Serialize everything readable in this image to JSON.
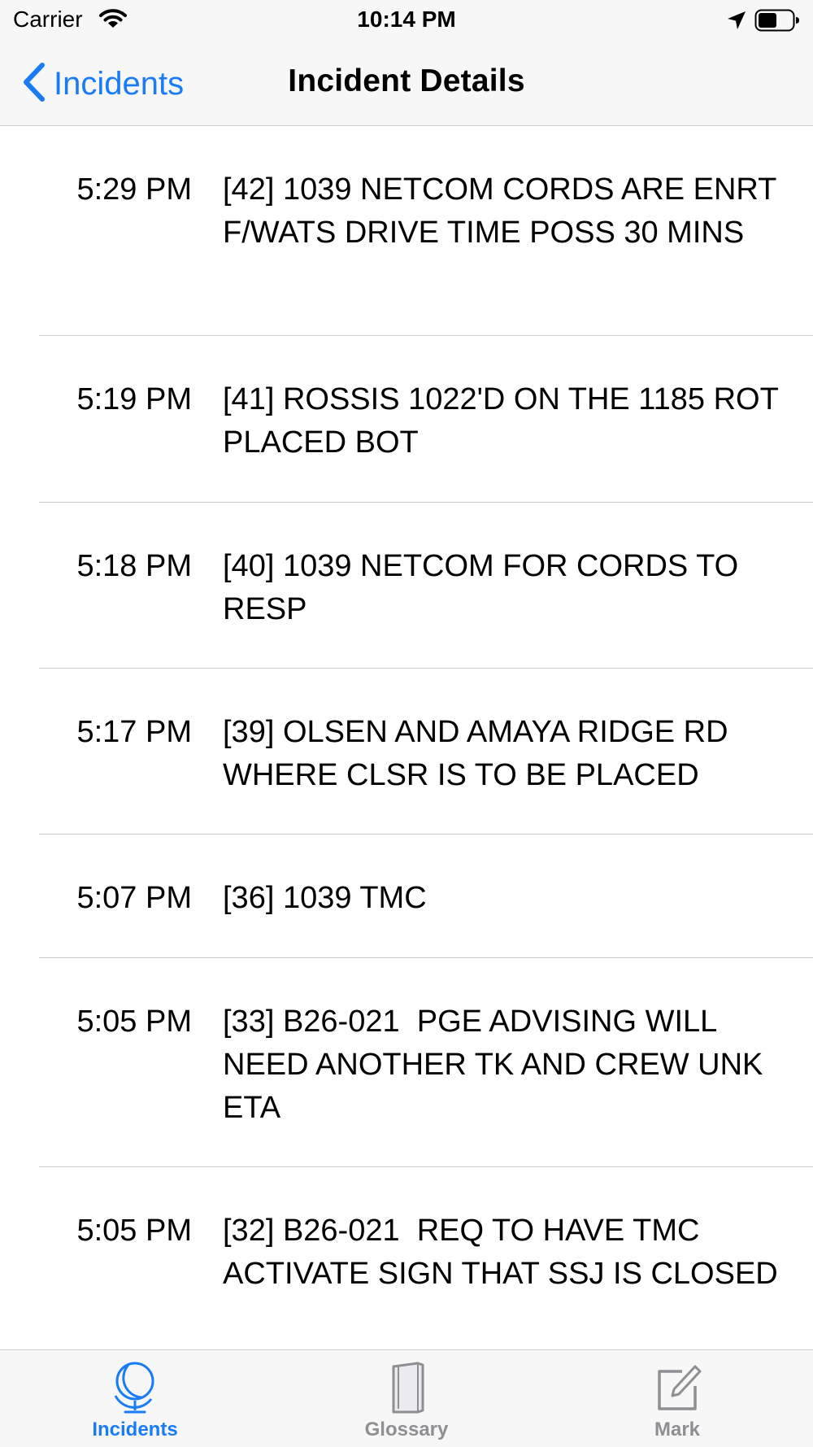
{
  "status_bar": {
    "carrier": "Carrier",
    "time": "10:14 PM"
  },
  "nav": {
    "back_label": "Incidents",
    "title": "Incident Details"
  },
  "entries": [
    {
      "time": "5:29 PM",
      "text": "[42] 1039 NETCOM CORDS ARE ENRT F/WATS DRIVE TIME POSS 30 MINS"
    },
    {
      "time": "5:19 PM",
      "text": "[41] ROSSIS 1022'D ON THE 1185 ROT PLACED BOT"
    },
    {
      "time": "5:18 PM",
      "text": "[40] 1039 NETCOM FOR CORDS TO RESP"
    },
    {
      "time": "5:17 PM",
      "text": "[39] OLSEN AND AMAYA RIDGE RD WHERE CLSR IS TO BE PLACED"
    },
    {
      "time": "5:07 PM",
      "text": "[36] 1039 TMC"
    },
    {
      "time": "5:05 PM",
      "text": "[33] B26-021  PGE ADVISING WILL NEED ANOTHER TK AND CREW UNK ETA"
    },
    {
      "time": "5:05 PM",
      "text": "[32] B26-021  REQ TO HAVE TMC ACTIVATE SIGN THAT SSJ IS CLOSED"
    }
  ],
  "tabs": [
    {
      "label": "Incidents",
      "icon": "globe-icon",
      "active": true
    },
    {
      "label": "Glossary",
      "icon": "book-icon",
      "active": false
    },
    {
      "label": "Mark",
      "icon": "compose-icon",
      "active": false
    }
  ],
  "colors": {
    "accent": "#1a7cf5",
    "inactive": "#8e8e93",
    "bar_background": "#f7f7f7",
    "separator": "#cfcfd3"
  }
}
